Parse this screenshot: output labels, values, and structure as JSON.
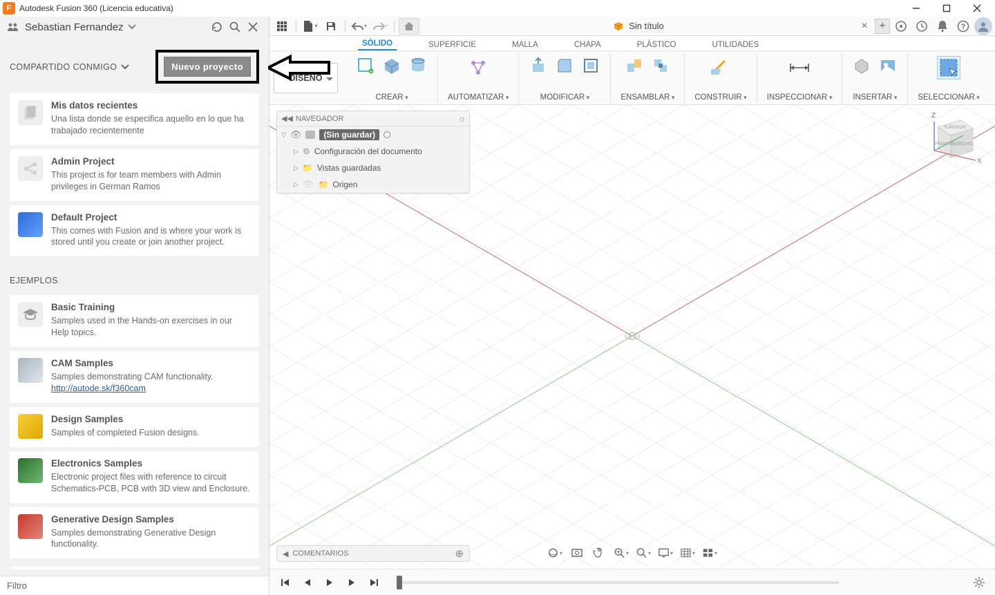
{
  "window": {
    "title": "Autodesk Fusion 360 (Licencia educativa)"
  },
  "sidebar": {
    "username": "Sebastian Fernandez",
    "section_shared": "COMPARTIDO CONMIGO",
    "new_project_btn": "Nuevo proyecto",
    "section_examples": "EJEMPLOS",
    "filter_label": "Filtro",
    "cards": [
      {
        "title": "Mis datos recientes",
        "desc": "Una lista donde se especifica aquello en lo que ha trabajado recientemente"
      },
      {
        "title": "Admin Project",
        "desc": "This project is for team members with Admin privileges in German Ramos"
      },
      {
        "title": "Default Project",
        "desc": "This comes with Fusion and is where your work is stored until you create or join another project."
      }
    ],
    "examples": [
      {
        "title": "Basic Training",
        "desc": "Samples used in the Hands-on exercises in our Help topics."
      },
      {
        "title": "CAM Samples",
        "desc": "Samples demonstrating CAM functionality.",
        "link": "http://autode.sk/f360cam"
      },
      {
        "title": "Design Samples",
        "desc": "Samples of completed Fusion designs."
      },
      {
        "title": "Electronics Samples",
        "desc": "Electronic project files with reference to circuit Schematics-PCB, PCB with 3D view and Enclosure."
      },
      {
        "title": "Generative Design Samples",
        "desc": "Samples demonstrating Generative Design functionality."
      }
    ]
  },
  "qat": {
    "doc_title": "Sin título"
  },
  "ribbon": {
    "design_label": "DISEÑO",
    "tabs": [
      "SÓLIDO",
      "SUPERFICIE",
      "MALLA",
      "CHAPA",
      "PLÁSTICO",
      "UTILIDADES"
    ],
    "groups": {
      "crear": "CREAR",
      "automatizar": "AUTOMATIZAR",
      "modificar": "MODIFICAR",
      "ensamblar": "ENSAMBLAR",
      "construir": "CONSTRUIR",
      "inspeccionar": "INSPECCIONAR",
      "insertar": "INSERTAR",
      "seleccionar": "SELECCIONAR"
    }
  },
  "browser": {
    "panel_title": "NAVEGADOR",
    "root": "(Sin guardar)",
    "items": [
      "Configuración del documento",
      "Vistas guardadas",
      "Origen"
    ]
  },
  "comments": {
    "label": "COMENTARIOS"
  },
  "viewcube": {
    "top": "SUPERIOR",
    "front": "FRONTAL",
    "right": "DERECHO"
  }
}
